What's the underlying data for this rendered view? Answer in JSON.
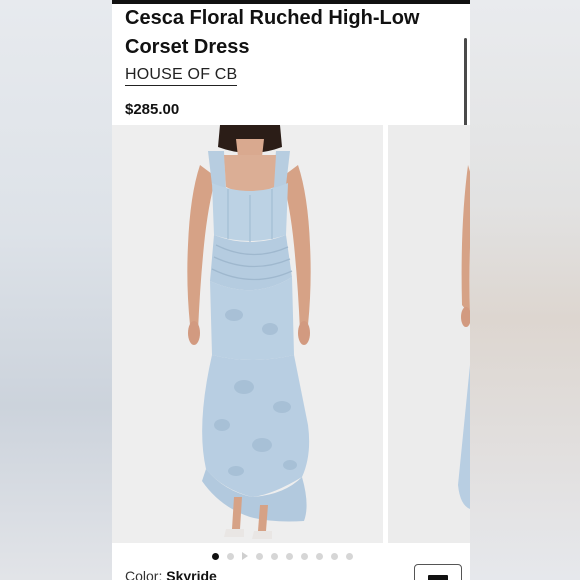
{
  "product": {
    "title": "Cesca Floral Ruched High-Low Corset Dress",
    "brand": "HOUSE OF CB",
    "price": "$285.00",
    "color_label": "Color:",
    "color_value": "Skyride"
  },
  "gallery": {
    "dot_count": 10,
    "active_index": 0,
    "dress_color": "#b9cfe0",
    "pattern_color": "#a9c1d6"
  },
  "icons": {
    "gallery_video": "play-icon",
    "size_guide": "ruler-icon"
  }
}
